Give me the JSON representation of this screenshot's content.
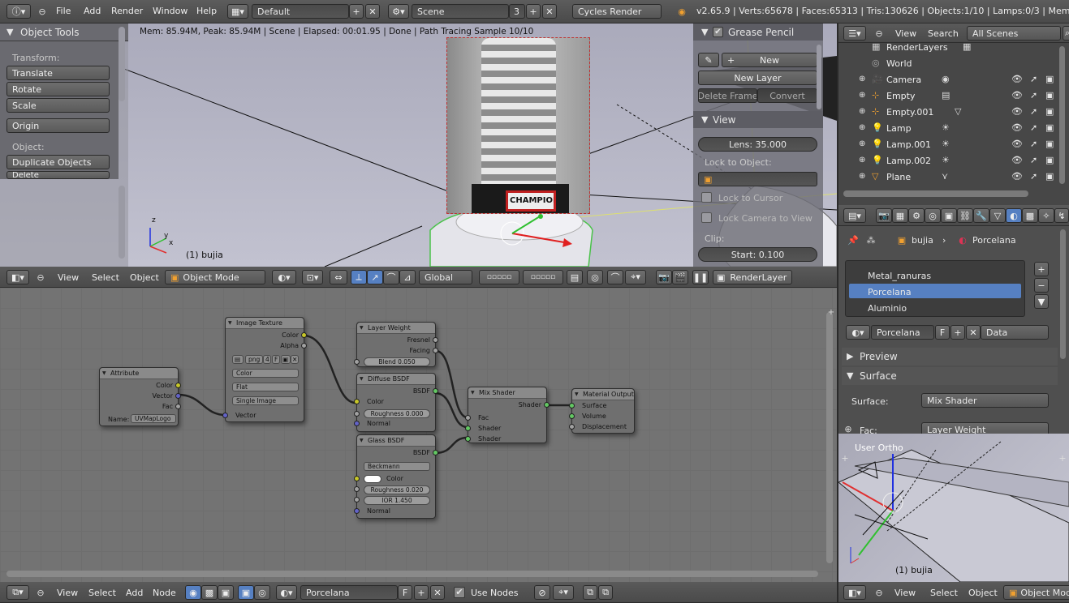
{
  "top_bar": {
    "menus": [
      "File",
      "Add",
      "Render",
      "Window",
      "Help"
    ],
    "screen_layout": "Default",
    "scene": "Scene",
    "scene_users": "3",
    "engine": "Cycles Render",
    "stats": "v2.65.9 | Verts:65678 | Faces:65313 | Tris:130626 | Objects:1/10 | Lamps:0/3 | Mem:36.72"
  },
  "viewport": {
    "status": "Mem: 85.94M, Peak: 85.94M | Scene | Elapsed: 00:01.95 | Done | Path Tracing Sample 10/10",
    "object_label": "(1) bujia",
    "axis_labels": [
      "z",
      "y",
      "x"
    ],
    "render_text": "CHAMPION",
    "header": {
      "menus": [
        "View",
        "Select",
        "Object"
      ],
      "mode": "Object Mode",
      "orientation": "Global",
      "render_layer": "RenderLayer"
    }
  },
  "tool_shelf": {
    "title": "Object Tools",
    "transform_label": "Transform:",
    "buttons": [
      "Translate",
      "Rotate",
      "Scale"
    ],
    "origin": "Origin",
    "object_label": "Object:",
    "duplicate": "Duplicate Objects",
    "delete": "Delete"
  },
  "properties_panel": {
    "grease_pencil": "Grease Pencil",
    "new": "New",
    "new_layer": "New Layer",
    "delete_frame": "Delete Frame",
    "convert": "Convert",
    "view": "View",
    "lens": "Lens: 35.000",
    "lock_to_object": "Lock to Object:",
    "lock_to_cursor": "Lock to Cursor",
    "lock_camera": "Lock Camera to View",
    "clip": "Clip:",
    "clip_start": "Start: 0.100"
  },
  "outliner": {
    "menus": [
      "View",
      "Search"
    ],
    "display": "All Scenes",
    "items": [
      "RenderLayers",
      "World",
      "Camera",
      "Empty",
      "Empty.001",
      "Lamp",
      "Lamp.001",
      "Lamp.002",
      "Plane"
    ]
  },
  "material_panel": {
    "breadcrumb_object": "bujia",
    "breadcrumb_material": "Porcelana",
    "slots": [
      "Metal_ranuras",
      "Porcelana",
      "Aluminio"
    ],
    "selected_slot": "Porcelana",
    "material_name": "Porcelana",
    "fake_user": "F",
    "link": "Data",
    "preview": "Preview",
    "surface_section": "Surface",
    "surface_label": "Surface:",
    "surface_value": "Mix Shader",
    "fac_label": "Fac:",
    "fac_value": "Layer Weight"
  },
  "mini_view": {
    "title": "User Ortho",
    "object_label": "(1) bujia",
    "menus": [
      "View",
      "Select",
      "Object"
    ],
    "mode": "Object Mode"
  },
  "node_editor": {
    "nodes": {
      "attribute": {
        "title": "Attribute",
        "outputs": [
          "Color",
          "Vector",
          "Fac"
        ],
        "name_label": "Name:",
        "name_value": "UVMapLogo"
      },
      "image_texture": {
        "title": "Image Texture",
        "outputs": [
          "Color",
          "Alpha"
        ],
        "image": "png",
        "users": "4",
        "fake": "F",
        "color_space": "Color",
        "projection": "Flat",
        "source": "Single Image",
        "input": "Vector"
      },
      "layer_weight": {
        "title": "Layer Weight",
        "outputs": [
          "Fresnel",
          "Facing"
        ],
        "blend": "Blend 0.050"
      },
      "diffuse": {
        "title": "Diffuse BSDF",
        "output": "BSDF",
        "inputs": [
          "Color",
          "Roughness 0.000",
          "Normal"
        ]
      },
      "glass": {
        "title": "Glass BSDF",
        "output": "BSDF",
        "distribution": "Beckmann",
        "inputs": [
          "Color",
          "Roughness 0.020",
          "IOR 1.450",
          "Normal"
        ]
      },
      "mix": {
        "title": "Mix Shader",
        "output": "Shader",
        "inputs": [
          "Fac",
          "Shader",
          "Shader"
        ]
      },
      "output": {
        "title": "Material Output",
        "inputs": [
          "Surface",
          "Volume",
          "Displacement"
        ]
      }
    },
    "header": {
      "menus": [
        "View",
        "Select",
        "Add",
        "Node"
      ],
      "material": "Porcelana",
      "fake": "F",
      "use_nodes": "Use Nodes"
    }
  },
  "colors": {
    "selection": "#5680c2",
    "viewport_bg": "#b6b6c8",
    "node_bg": "#737373"
  }
}
